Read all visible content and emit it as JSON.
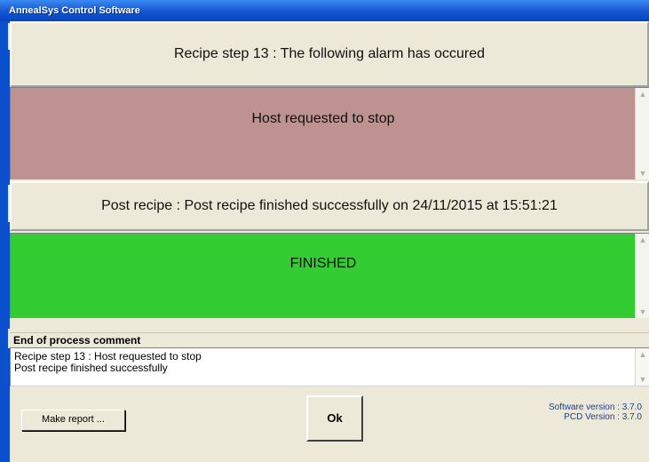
{
  "window": {
    "title": "AnnealSys Control Software"
  },
  "alarm": {
    "banner_text": "Recipe step 13 : The following alarm has occured",
    "message": "Host requested to stop",
    "panel_color": "#bd9290"
  },
  "post_recipe": {
    "banner_text": "Post recipe : Post recipe finished successfully on 24/11/2015 at 15:51:21",
    "status": "FINISHED",
    "panel_color": "#33cc33"
  },
  "comment": {
    "label": "End of process comment",
    "lines": [
      "Recipe step 13 : Host requested to stop",
      "Post recipe finished successfully"
    ]
  },
  "buttons": {
    "ok_label": "Ok",
    "report_label": "Make report ..."
  },
  "version": {
    "software": "Software version : 3.7.0",
    "pcd": "PCD Version : 3.7.0"
  }
}
